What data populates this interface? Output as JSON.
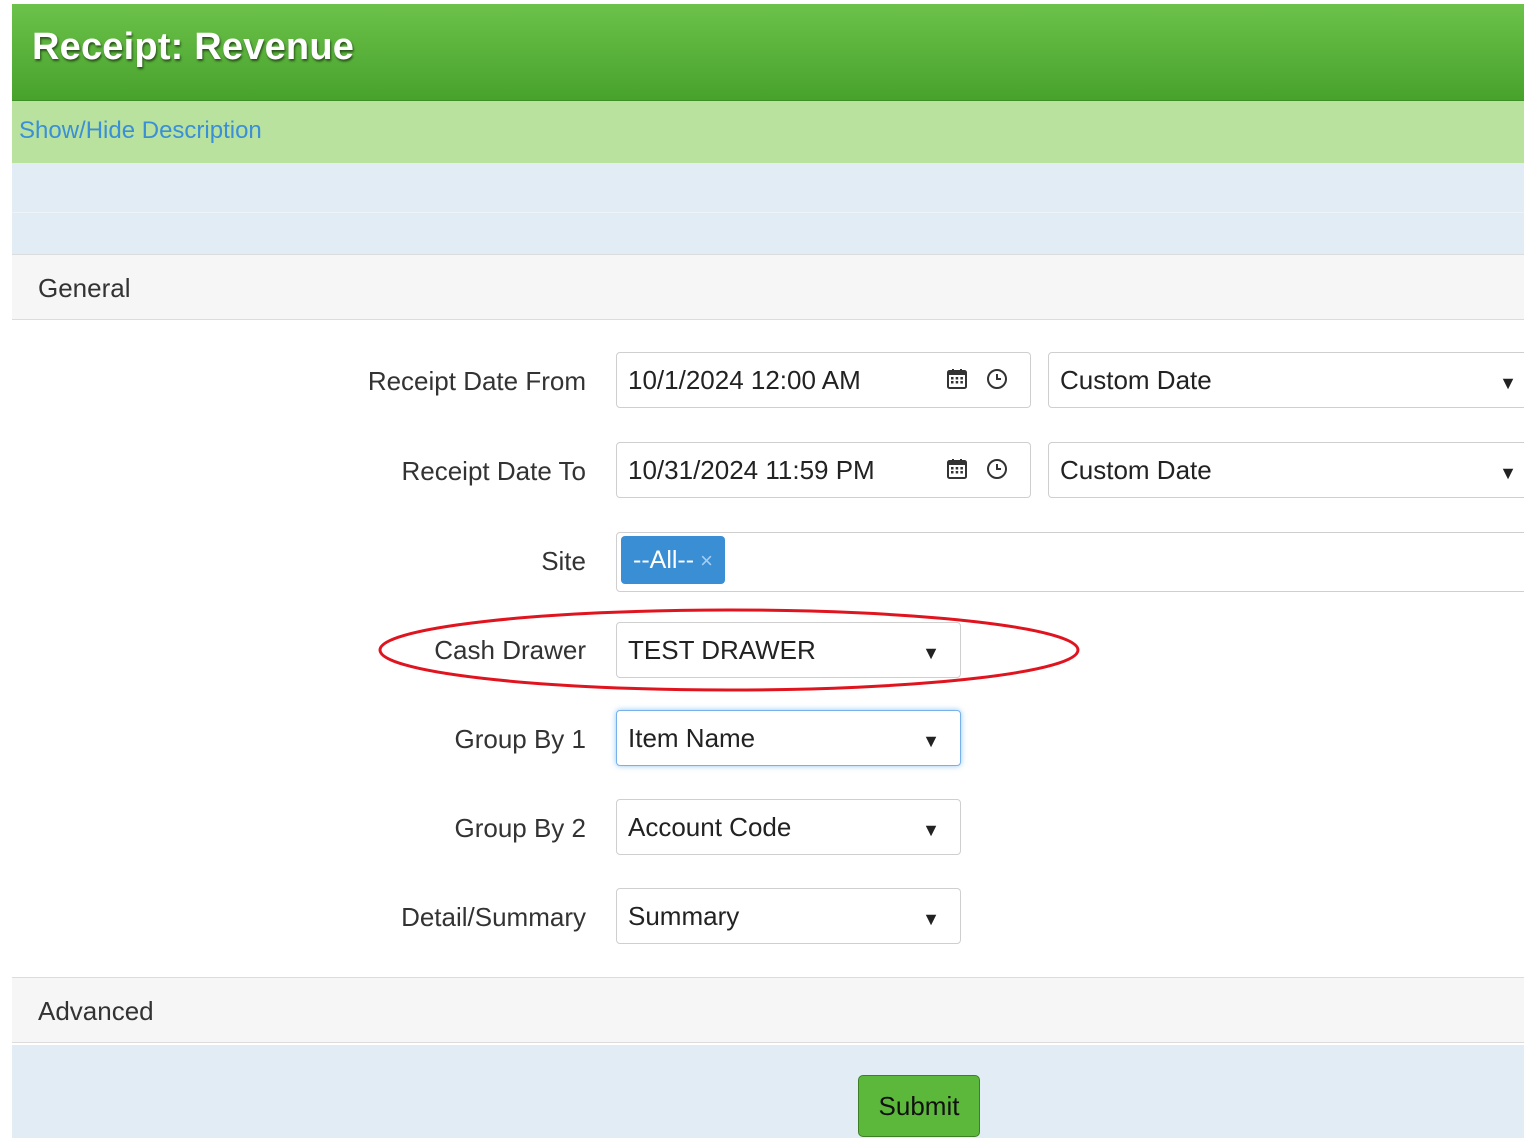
{
  "header": {
    "title": "Receipt: Revenue"
  },
  "description": {
    "toggle_label": "Show/Hide Description"
  },
  "sections": {
    "general": "General",
    "advanced": "Advanced"
  },
  "form": {
    "receipt_date_from": {
      "label": "Receipt Date From",
      "value": "10/1/2024 12:00 AM",
      "preset": "Custom Date"
    },
    "receipt_date_to": {
      "label": "Receipt Date To",
      "value": "10/31/2024 11:59 PM",
      "preset": "Custom Date"
    },
    "site": {
      "label": "Site",
      "tags": [
        "--All--"
      ],
      "tag_remove": "×"
    },
    "cash_drawer": {
      "label": "Cash Drawer",
      "value": "TEST DRAWER"
    },
    "group_by_1": {
      "label": "Group By 1",
      "value": "Item Name"
    },
    "group_by_2": {
      "label": "Group By 2",
      "value": "Account Code"
    },
    "detail_summary": {
      "label": "Detail/Summary",
      "value": "Summary"
    }
  },
  "actions": {
    "submit_label": "Submit"
  },
  "icons": {
    "calendar": "calendar-icon",
    "clock": "clock-icon",
    "dropdown": "caret-down-icon"
  },
  "colors": {
    "header_green": "#5bb53a",
    "desc_bar": "#b8e29e",
    "band_blue": "#e2ecf5",
    "tag_blue": "#3a8ed4",
    "submit_green": "#5cb83a",
    "annotation_red": "#e0141e"
  }
}
